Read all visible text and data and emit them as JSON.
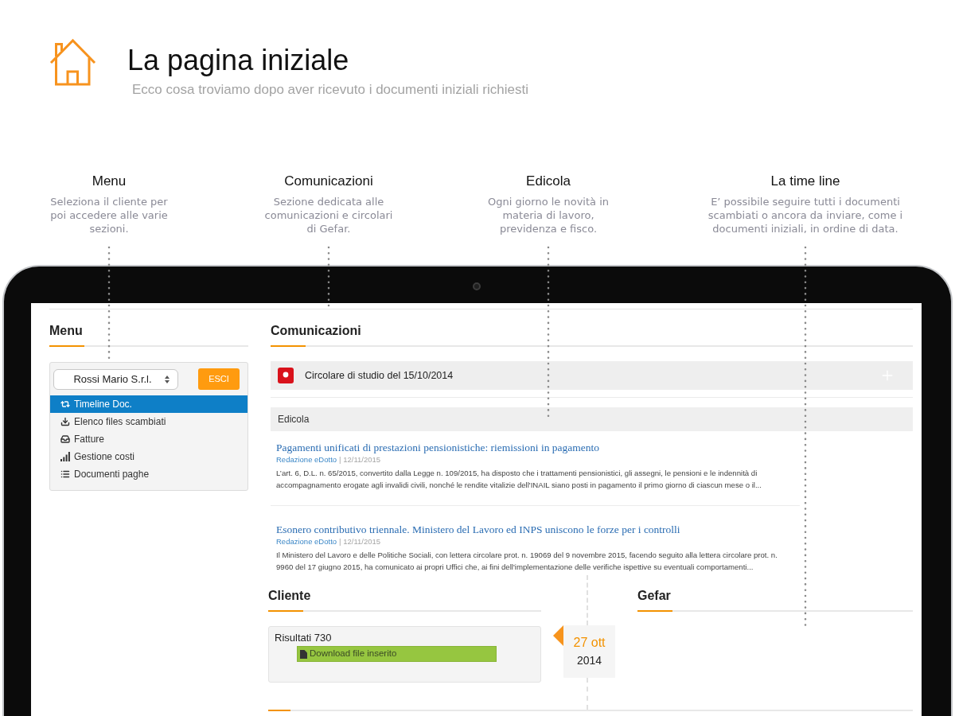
{
  "header": {
    "title": "La pagina iniziale",
    "subtitle": "Ecco cosa troviamo dopo aver ricevuto i documenti iniziali richiesti"
  },
  "callouts": [
    {
      "title": "Menu",
      "description": "Seleziona il cliente per poi accedere alle varie sezioni."
    },
    {
      "title": "Comunicazioni",
      "description": "Sezione dedicata alle comunicazioni e circolari di Gefar."
    },
    {
      "title": "Edicola",
      "description": "Ogni giorno le novità in materia di lavoro, previdenza e fisco."
    },
    {
      "title": "La time line",
      "description": "E’ possibile seguire tutti i documenti scambiati o ancora da inviare, come i documenti iniziali, in ordine di data."
    }
  ],
  "app": {
    "menu": {
      "heading": "Menu",
      "client_select": {
        "value": "Rossi Mario S.r.l."
      },
      "logout_button": "ESCI",
      "items": [
        {
          "label": "Timeline Doc.",
          "selected": true
        },
        {
          "label": "Elenco files scambiati",
          "selected": false
        },
        {
          "label": "Fatture",
          "selected": false
        },
        {
          "label": "Gestione costi",
          "selected": false
        },
        {
          "label": "Documenti paghe",
          "selected": false
        }
      ]
    },
    "communications": {
      "heading": "Comunicazioni",
      "items": [
        {
          "title": "Circolare di studio del 15/10/2014"
        }
      ]
    },
    "edicola": {
      "heading": "Edicola",
      "articles": [
        {
          "title": "Pagamenti unificati di prestazioni pensionistiche: riemissioni in pagamento",
          "author": "Redazione eDotto",
          "date": "| 12/11/2015",
          "summary": "L’art. 6, D.L. n. 65/2015, convertito dalla Legge n. 109/2015, ha disposto che i trattamenti pensionistici, gli assegni, le pensioni e le indennità di accompagnamento erogate agli invalidi civili, nonché le rendite vitalizie dell'INAIL siano posti in pagamento il primo giorno di ciascun mese o il..."
        },
        {
          "title": "Esonero contributivo triennale. Ministero del Lavoro ed INPS uniscono le forze per i controlli",
          "author": "Redazione eDotto",
          "date": "| 12/11/2015",
          "summary": "Il Ministero del Lavoro e delle Politiche Sociali, con lettera circolare prot. n. 19069 del 9 novembre 2015, facendo seguito alla lettera circolare prot. n. 9960 del 17 giugno 2015, ha comunicato ai propri Uffici che, ai fini dell'implementazione delle verifiche ispettive su eventuali comportamenti..."
        }
      ]
    },
    "timeline": {
      "client_heading": "Cliente",
      "studio_heading": "Gefar",
      "entries": [
        {
          "title": "Risultati 730",
          "action": "Download file inserito",
          "day": "27 ott",
          "year": "2014"
        }
      ]
    }
  }
}
